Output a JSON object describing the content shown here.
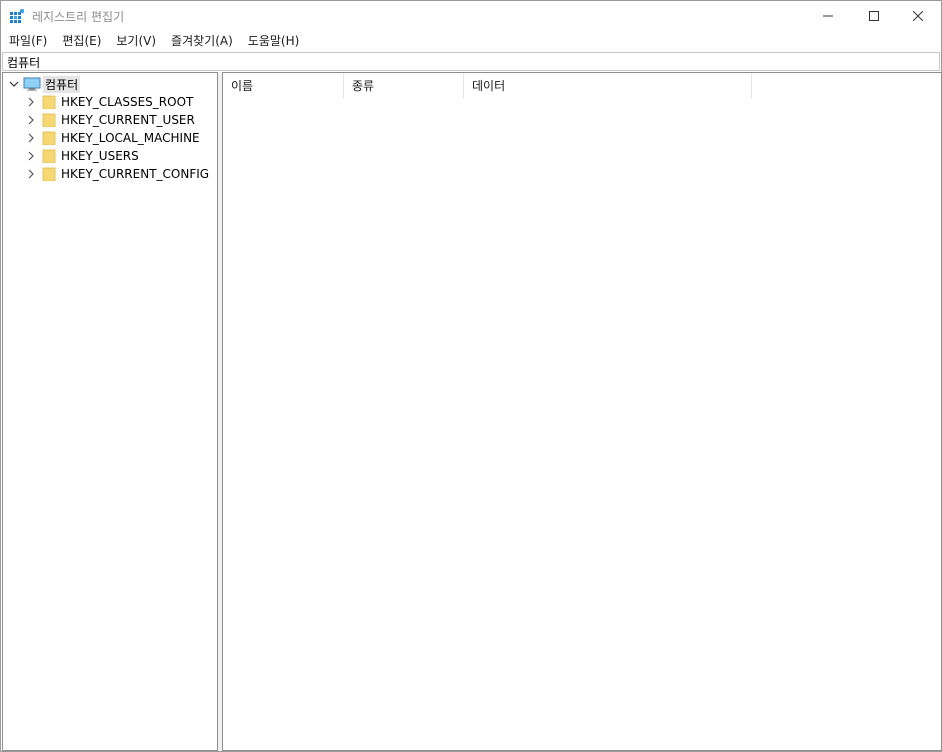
{
  "window": {
    "title": "레지스트리 편집기"
  },
  "menu": [
    {
      "label": "파일(F)"
    },
    {
      "label": "편집(E)"
    },
    {
      "label": "보기(V)"
    },
    {
      "label": "즐겨찾기(A)"
    },
    {
      "label": "도움말(H)"
    }
  ],
  "address": {
    "value": "컴퓨터"
  },
  "tree": {
    "root": {
      "label": "컴퓨터",
      "icon": "computer-icon",
      "expanded": true
    },
    "children": [
      {
        "label": "HKEY_CLASSES_ROOT",
        "icon": "folder-icon"
      },
      {
        "label": "HKEY_CURRENT_USER",
        "icon": "folder-icon"
      },
      {
        "label": "HKEY_LOCAL_MACHINE",
        "icon": "folder-icon"
      },
      {
        "label": "HKEY_USERS",
        "icon": "folder-icon"
      },
      {
        "label": "HKEY_CURRENT_CONFIG",
        "icon": "folder-icon"
      }
    ]
  },
  "list": {
    "columns": [
      {
        "label": "이름"
      },
      {
        "label": "종류"
      },
      {
        "label": "데이터"
      }
    ]
  },
  "colors": {
    "folder": "#f5d56a",
    "accent": "#1e90d6"
  }
}
